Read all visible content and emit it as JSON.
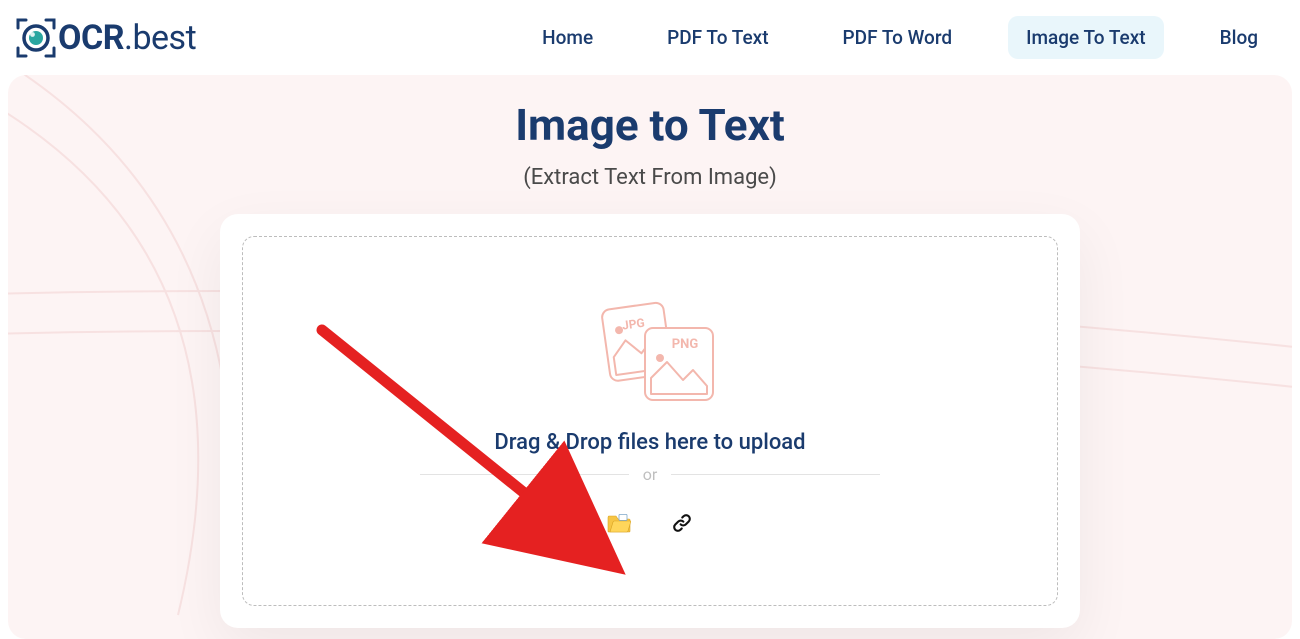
{
  "logo": {
    "ocr": "OCR",
    "dot": ".",
    "best": "best"
  },
  "nav": {
    "home": "Home",
    "pdf_text": "PDF To Text",
    "pdf_word": "PDF To Word",
    "image_text": "Image To Text",
    "blog": "Blog"
  },
  "hero": {
    "title": "Image to Text",
    "subtitle": "(Extract Text From Image)"
  },
  "dropzone": {
    "instruction": "Drag & Drop files here to upload",
    "or": "or",
    "jpg": "JPG",
    "png": "PNG"
  },
  "annotation": {
    "arrow_color": "#e52121"
  }
}
